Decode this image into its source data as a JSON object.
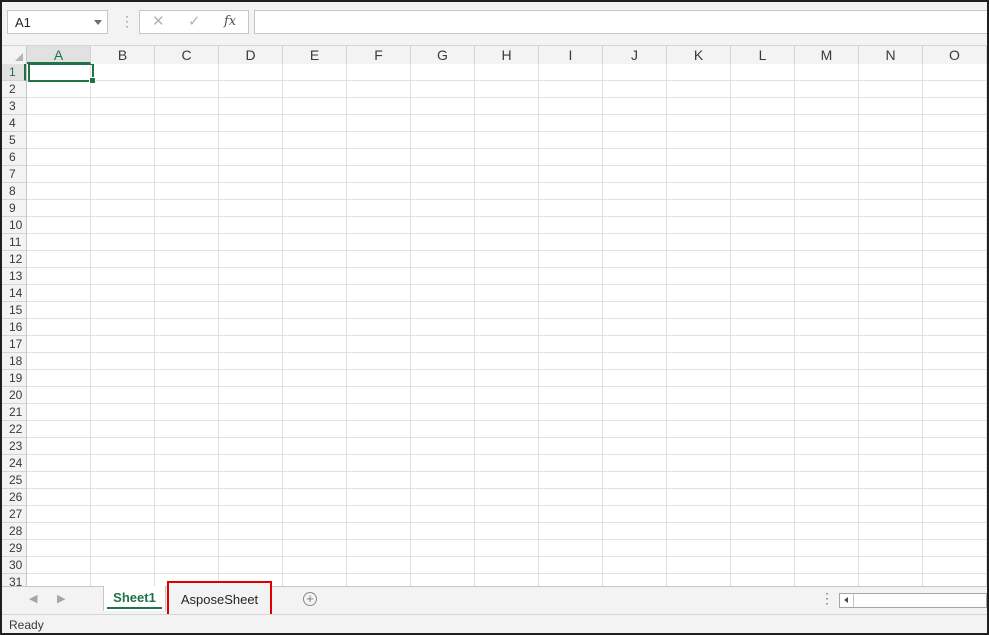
{
  "formula_bar": {
    "name_box": "A1",
    "cancel_glyph": "✕",
    "enter_glyph": "✓",
    "function_glyph": "fx",
    "formula_value": ""
  },
  "columns": [
    "A",
    "B",
    "C",
    "D",
    "E",
    "F",
    "G",
    "H",
    "I",
    "J",
    "K",
    "L",
    "M",
    "N",
    "O"
  ],
  "rows": [
    "1",
    "2",
    "3",
    "4",
    "5",
    "6",
    "7",
    "8",
    "9",
    "10",
    "11",
    "12",
    "13",
    "14",
    "15",
    "16",
    "17",
    "18",
    "19",
    "20",
    "21",
    "22",
    "23",
    "24",
    "25",
    "26",
    "27",
    "28",
    "29",
    "30",
    "31"
  ],
  "active_cell": {
    "column": "A",
    "row": "1"
  },
  "sheet_tabs": {
    "prev_glyph": "◀",
    "next_glyph": "▶",
    "tabs": [
      {
        "label": "Sheet1",
        "active": true
      },
      {
        "label": "AsposeSheet",
        "active": false,
        "highlighted": true
      }
    ],
    "add_glyph": "+"
  },
  "status_bar": {
    "text": "Ready"
  },
  "colors": {
    "accent": "#217346",
    "highlight": "#e00000"
  }
}
